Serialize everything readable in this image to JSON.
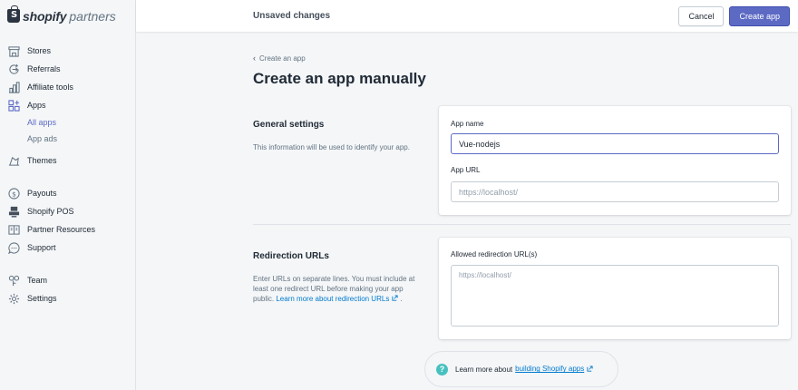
{
  "brand": {
    "name": "shopify",
    "sub": "partners"
  },
  "topbar": {
    "status": "Unsaved changes",
    "cancel_label": "Cancel",
    "create_label": "Create app"
  },
  "sidebar": {
    "items": [
      {
        "label": "Stores",
        "icon": "store-icon"
      },
      {
        "label": "Referrals",
        "icon": "referral-icon"
      },
      {
        "label": "Affiliate tools",
        "icon": "chart-icon"
      },
      {
        "label": "Apps",
        "icon": "apps-icon"
      },
      {
        "label": "Themes",
        "icon": "themes-icon"
      },
      {
        "label": "Payouts",
        "icon": "dollar-icon"
      },
      {
        "label": "Shopify POS",
        "icon": "pos-icon"
      },
      {
        "label": "Partner Resources",
        "icon": "book-icon"
      },
      {
        "label": "Support",
        "icon": "chat-icon"
      },
      {
        "label": "Team",
        "icon": "team-icon"
      },
      {
        "label": "Settings",
        "icon": "gear-icon"
      }
    ],
    "apps_sub": [
      {
        "label": "All apps",
        "active": true
      },
      {
        "label": "App ads",
        "active": false
      }
    ]
  },
  "page": {
    "breadcrumb": "Create an app",
    "title": "Create an app manually"
  },
  "general": {
    "title": "General settings",
    "description": "This information will be used to identify your app.",
    "app_name_label": "App name",
    "app_name_value": "Vue-nodejs",
    "app_url_label": "App URL",
    "app_url_placeholder": "https://localhost/"
  },
  "redirection": {
    "title": "Redirection URLs",
    "description": "Enter URLs on separate lines. You must include at least one redirect URL before making your app public.",
    "link_text": "Learn more about redirection URLs",
    "field_label": "Allowed redirection URL(s)",
    "placeholder": "https://localhost/"
  },
  "footer": {
    "text": "Learn more about",
    "link": "building Shopify apps"
  },
  "colors": {
    "accent": "#5c6ac4",
    "link": "#007ace",
    "help": "#47c1bf"
  }
}
